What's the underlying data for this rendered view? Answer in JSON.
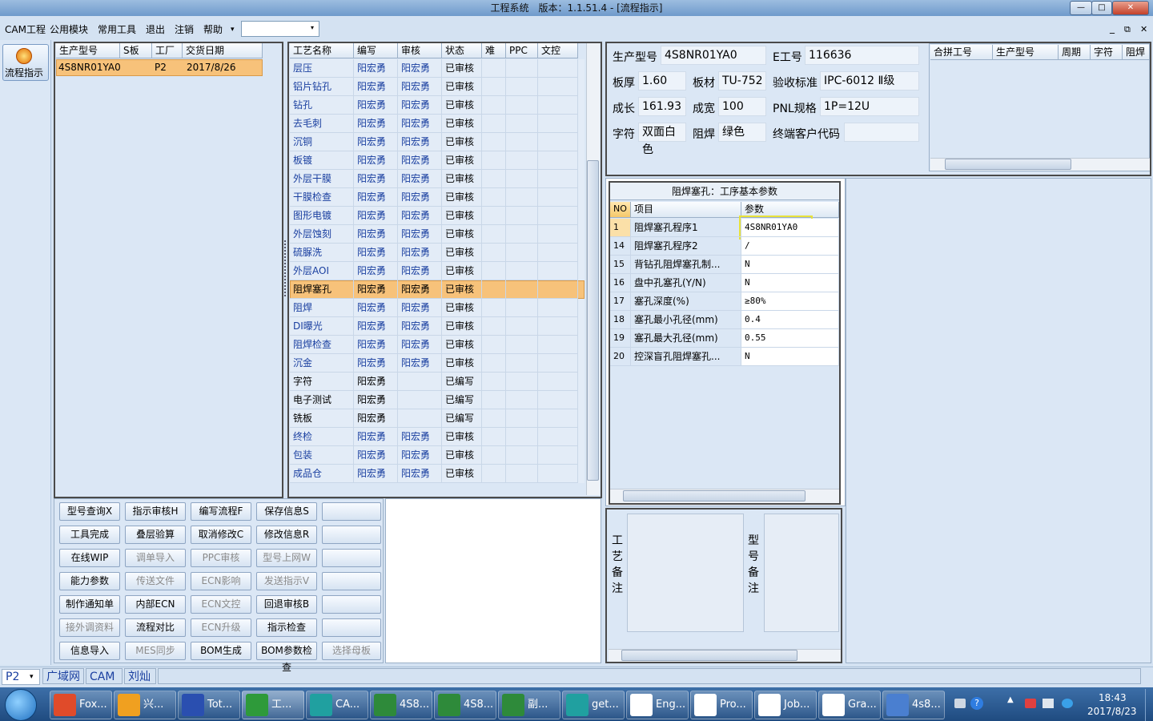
{
  "window": {
    "title": "工程系统　版本：1.1.51.4 - [流程指示]",
    "min": "—",
    "max": "□",
    "close": "✕"
  },
  "menu": [
    "CAM工程",
    "公用模块",
    "常用工具",
    "退出",
    "注销",
    "帮助"
  ],
  "menu_help_arrow": "▾",
  "menucombo_arrow": "▾",
  "mdi": {
    "min": "_",
    "restore": "⧉",
    "close": "✕"
  },
  "sidebar": {
    "flow_label": "流程指示"
  },
  "order_table": {
    "headers": [
      "生产型号",
      "S板",
      "工厂",
      "交货日期"
    ],
    "row": [
      "4S8NR01YA0",
      "",
      "P2",
      "2017/8/26"
    ]
  },
  "process_table": {
    "headers": [
      "工艺名称",
      "编写",
      "审核",
      "状态",
      "难",
      "PPC",
      "文控"
    ],
    "rows": [
      [
        "层压",
        "阳宏勇",
        "阳宏勇",
        "已审核"
      ],
      [
        "铝片钻孔",
        "阳宏勇",
        "阳宏勇",
        "已审核"
      ],
      [
        "钻孔",
        "阳宏勇",
        "阳宏勇",
        "已审核"
      ],
      [
        "去毛刺",
        "阳宏勇",
        "阳宏勇",
        "已审核"
      ],
      [
        "沉铜",
        "阳宏勇",
        "阳宏勇",
        "已审核"
      ],
      [
        "板镀",
        "阳宏勇",
        "阳宏勇",
        "已审核"
      ],
      [
        "外层干膜",
        "阳宏勇",
        "阳宏勇",
        "已审核"
      ],
      [
        "干膜检查",
        "阳宏勇",
        "阳宏勇",
        "已审核"
      ],
      [
        "图形电镀",
        "阳宏勇",
        "阳宏勇",
        "已审核"
      ],
      [
        "外层蚀刻",
        "阳宏勇",
        "阳宏勇",
        "已审核"
      ],
      [
        "硫脲洗",
        "阳宏勇",
        "阳宏勇",
        "已审核"
      ],
      [
        "外层AOI",
        "阳宏勇",
        "阳宏勇",
        "已审核"
      ],
      [
        "阻焊塞孔",
        "阳宏勇",
        "阳宏勇",
        "已审核"
      ],
      [
        "阻焊",
        "阳宏勇",
        "阳宏勇",
        "已审核"
      ],
      [
        "DI曝光",
        "阳宏勇",
        "阳宏勇",
        "已审核"
      ],
      [
        "阻焊检查",
        "阳宏勇",
        "阳宏勇",
        "已审核"
      ],
      [
        "沉金",
        "阳宏勇",
        "阳宏勇",
        "已审核"
      ],
      [
        "字符",
        "阳宏勇",
        "",
        "已编写"
      ],
      [
        "电子测试",
        "阳宏勇",
        "",
        "已编写"
      ],
      [
        "铣板",
        "阳宏勇",
        "",
        "已编写"
      ],
      [
        "终检",
        "阳宏勇",
        "阳宏勇",
        "已审核"
      ],
      [
        "包装",
        "阳宏勇",
        "阳宏勇",
        "已审核"
      ],
      [
        "成品仓",
        "阳宏勇",
        "阳宏勇",
        "已审核"
      ]
    ]
  },
  "info": {
    "prod_model_lbl": "生产型号",
    "prod_model": "4S8NR01YA0",
    "e_no_lbl": "E工号",
    "e_no": "116636",
    "thick_lbl": "板厚",
    "thick": "1.60",
    "mat_lbl": "板材",
    "mat": "TU-752",
    "std_lbl": "验收标准",
    "std": "IPC-6012 Ⅱ级",
    "len_lbl": "成长",
    "len": "161.93",
    "wid_lbl": "成宽",
    "wid": "100",
    "pnl_lbl": "PNL规格",
    "pnl": "1P=12U",
    "char_lbl": "字符",
    "char": "双面白色",
    "mask_lbl": "阻焊",
    "mask": "绿色",
    "cust_lbl": "终端客户代码",
    "cust": ""
  },
  "merge_table": {
    "headers": [
      "合拼工号",
      "生产型号",
      "周期",
      "字符",
      "阻焊"
    ]
  },
  "params": {
    "title": "阻焊塞孔：工序基本参数",
    "headers": [
      "NO",
      "项目",
      "参数"
    ],
    "rows": [
      [
        "1",
        "阻焊塞孔程序1",
        "4S8NR01YA0"
      ],
      [
        "14",
        "阻焊塞孔程序2",
        "/"
      ],
      [
        "15",
        "背钻孔阻焊塞孔制...",
        "N"
      ],
      [
        "16",
        "盘中孔塞孔(Y/N)",
        "N"
      ],
      [
        "17",
        "塞孔深度(%)",
        "≥80%"
      ],
      [
        "18",
        "塞孔最小孔径(mm)",
        "0.4"
      ],
      [
        "19",
        "塞孔最大孔径(mm)",
        "0.55"
      ],
      [
        "20",
        "控深盲孔阻焊塞孔...",
        "N"
      ]
    ]
  },
  "remarks": {
    "process_label": "工艺备注",
    "model_label": "型号备注"
  },
  "buttons": [
    [
      "型号查询X",
      "指示审核H",
      "编写流程F",
      "保存信息S",
      ""
    ],
    [
      "工具完成",
      "叠层验算",
      "取消修改C",
      "修改信息R",
      ""
    ],
    [
      "在线WIP",
      "调单导入",
      "PPC审核",
      "型号上网W",
      ""
    ],
    [
      "能力参数",
      "传送文件",
      "ECN影响",
      "发送指示V",
      ""
    ],
    [
      "制作通知单",
      "内部ECN",
      "ECN文控",
      "回退审核B",
      ""
    ],
    [
      "接外调资料",
      "流程对比",
      "ECN升级",
      "指示检查",
      ""
    ],
    [
      "信息导入",
      "MES同步",
      "BOM生成",
      "BOM参数检查",
      "选择母板"
    ]
  ],
  "disabled_buttons": [
    "调单导入",
    "PPC审核",
    "型号上网W",
    "传送文件",
    "ECN影响",
    "发送指示V",
    "ECN文控",
    "接外调资料",
    "ECN升级",
    "MES同步",
    "选择母板"
  ],
  "statusbar": {
    "plant": "P2",
    "items": [
      "广域网",
      "CAM",
      "刘灿"
    ]
  },
  "taskbar": {
    "items": [
      "Fox...",
      "兴...",
      "Tot...",
      "工...",
      "CA...",
      "4S8...",
      "4S8...",
      "副...",
      "get...",
      "Eng...",
      "Pro...",
      "Job...",
      "Gra...",
      "4s8..."
    ],
    "time": "18:43",
    "date": "2017/8/23"
  }
}
